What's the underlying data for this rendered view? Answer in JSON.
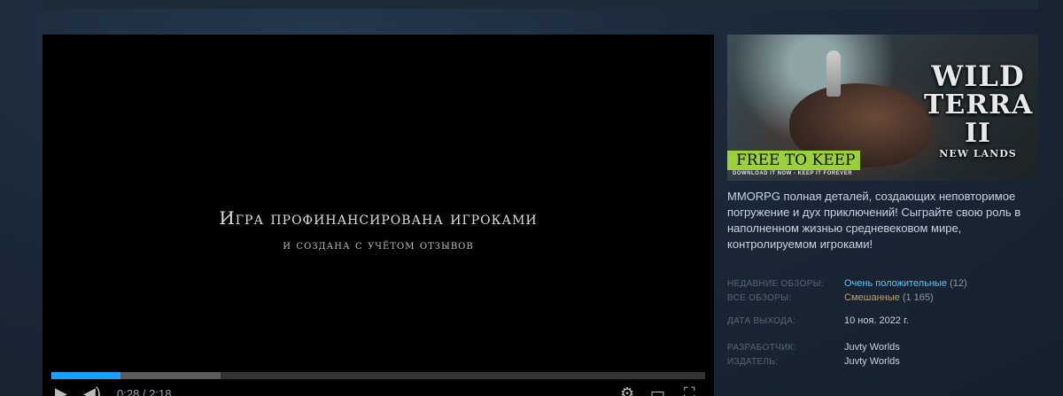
{
  "video": {
    "line1": "Игра профинансирована игроками",
    "line2": "и создана с учётом отзывов",
    "progress_played": 0.106,
    "progress_buffered": 0.259,
    "time_label": "0:28 / 2:18"
  },
  "capsule": {
    "logo_line1": "WILD",
    "logo_line2": "TERRA",
    "logo_roman": "II",
    "logo_sub": "NEW LANDS",
    "badge": "FREE TO KEEP",
    "badge_sub": "DOWNLOAD IT NOW - KEEP IT FOREVER"
  },
  "description": "MMORPG полная деталей, создающих неповторимое погружение и дух приключений! Сыграйте свою роль в наполненном жизнью средневековом мире, контролируемом игроками!",
  "reviews": {
    "recent_label": "НЕДАВНИЕ ОБЗОРЫ:",
    "recent_value": "Очень положительные",
    "recent_count": "(12)",
    "all_label": "ВСЕ ОБЗОРЫ:",
    "all_value": "Смешанные",
    "all_count": "(1 165)"
  },
  "release": {
    "label": "ДАТА ВЫХОДА:",
    "value": "10 ноя. 2022 г."
  },
  "developer": {
    "label": "РАЗРАБОТЧИК:",
    "value": "Juvty Worlds"
  },
  "publisher": {
    "label": "ИЗДАТЕЛЬ:",
    "value": "Juvty Worlds"
  },
  "colors": {
    "accent": "#1a9fff",
    "link": "#66c0f4",
    "mixed": "#b9a074",
    "badge": "#9ccf3c"
  },
  "icons": [
    "play-icon",
    "volume-icon",
    "settings-icon",
    "autoplay-icon",
    "fullscreen-icon"
  ]
}
